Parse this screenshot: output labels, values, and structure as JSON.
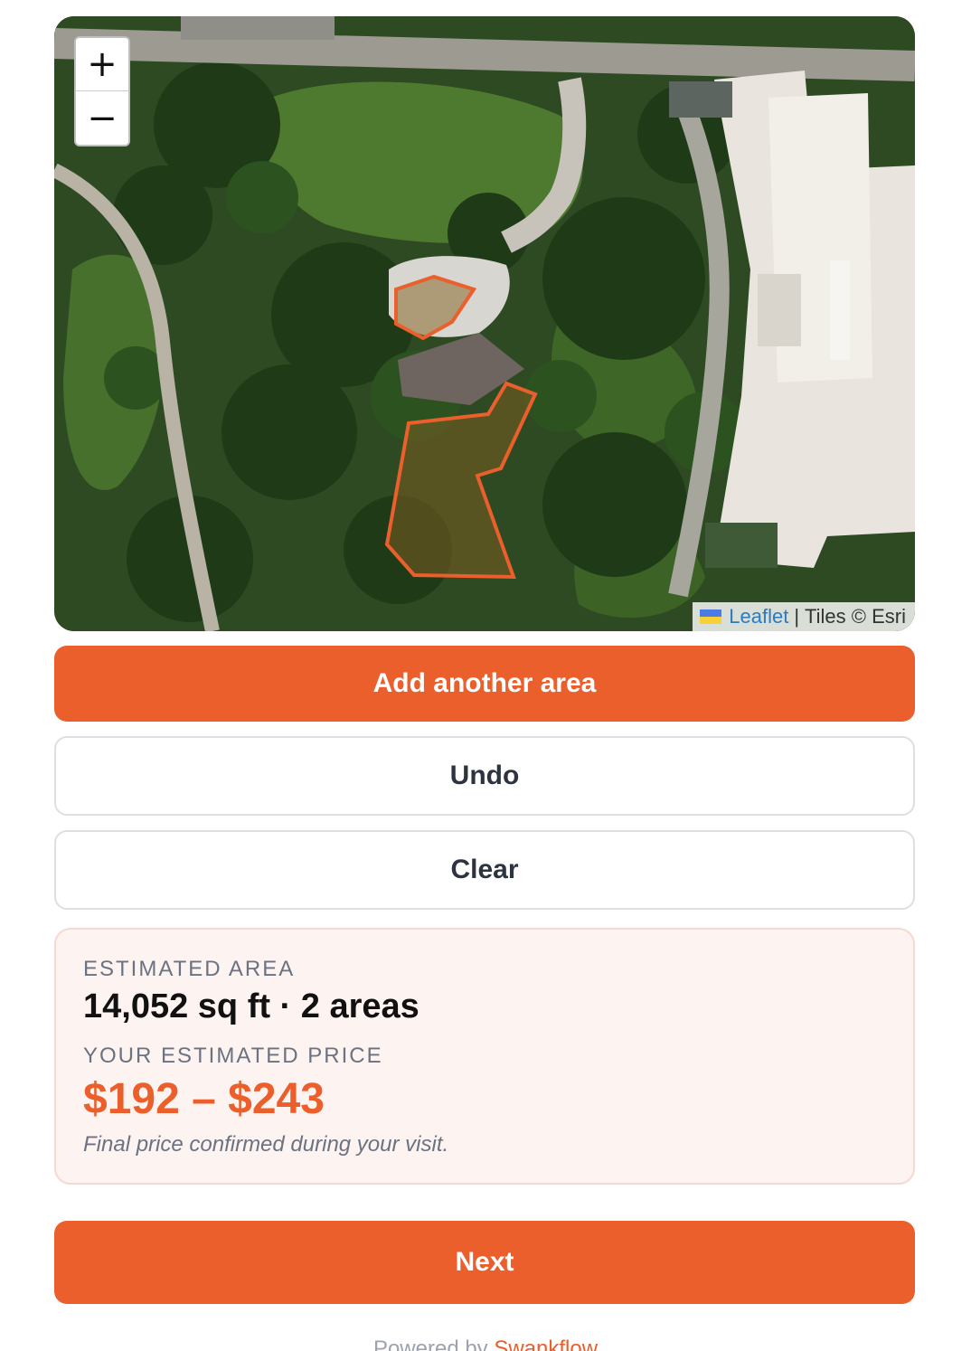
{
  "map": {
    "zoom_in_label": "+",
    "zoom_out_label": "−",
    "attribution": {
      "leaflet_link": "Leaflet",
      "separator": "|",
      "tiles": "Tiles © Esri"
    },
    "polygon_color": "#ea5f2b",
    "drawn_area_count": 2
  },
  "buttons": {
    "add_area": "Add another area",
    "undo": "Undo",
    "clear": "Clear",
    "next": "Next"
  },
  "estimate": {
    "area_label": "ESTIMATED AREA",
    "area_value": "14,052 sq ft · 2 areas",
    "price_label": "YOUR ESTIMATED PRICE",
    "price_value": "$192 – $243",
    "note": "Final price confirmed during your visit."
  },
  "footer": {
    "prefix": "Powered by ",
    "brand": "Swankflow"
  },
  "colors": {
    "accent": "#ea5f2b",
    "panel_bg": "#fdf3f1"
  }
}
